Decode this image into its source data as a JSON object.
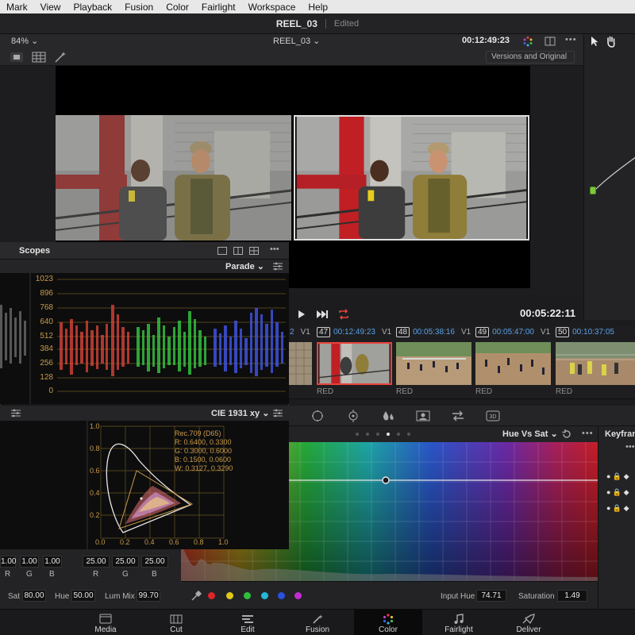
{
  "menubar": [
    "Mark",
    "View",
    "Playback",
    "Fusion",
    "Color",
    "Fairlight",
    "Workspace",
    "Help"
  ],
  "title": {
    "project": "REEL_03",
    "status": "Edited"
  },
  "viewer": {
    "zoom": "84%",
    "clip_name": "REEL_03",
    "timecode": "00:12:49:23",
    "compare_mode": "Versions and Original",
    "transport_timecode": "00:05:22:11"
  },
  "clips": [
    {
      "num": "47",
      "tc": "00:12:49:23",
      "track": "V1",
      "label": "RED"
    },
    {
      "num": "48",
      "tc": "00:05:38:16",
      "track": "V1",
      "label": "RED"
    },
    {
      "num": "49",
      "tc": "00:05:47:00",
      "track": "V1",
      "label": "RED"
    },
    {
      "num": "50",
      "tc": "00:10:37:05",
      "track": "V1",
      "label": "RED"
    }
  ],
  "clips_extra": {
    "prev_num_tail": "2",
    "prev_track": "V1",
    "first_label": "RED"
  },
  "scopes": {
    "title": "Scopes",
    "parade_mode": "Parade",
    "parade_ticks": [
      "1023",
      "896",
      "768",
      "640",
      "512",
      "384",
      "256",
      "128",
      "0"
    ],
    "cie_mode": "CIE 1931 xy",
    "cie_y_ticks": [
      "1.0",
      "0.8",
      "0.6",
      "0.4",
      "0.2"
    ],
    "cie_x_ticks": [
      "0.0",
      "0.2",
      "0.4",
      "0.6",
      "0.8",
      "1.0"
    ],
    "cie_info": [
      "Rec.709 (D65)",
      "R: 0.6400, 0.3300",
      "G: 0.3000, 0.6000",
      "B: 0.1500, 0.0600",
      "W: 0.3127, 0.3290"
    ]
  },
  "curves": {
    "mode": "Hue Vs Sat",
    "input_hue_label": "Input Hue",
    "input_hue_value": "74.71",
    "saturation_label": "Saturation",
    "saturation_value": "1.49",
    "swatches": [
      "#e0242a",
      "#e3c917",
      "#2fbf3b",
      "#25b7d8",
      "#2a52e0",
      "#c42bd1"
    ]
  },
  "keyframes_title": "Keyfram",
  "wheels": {
    "lift_vals": [
      "1.00",
      "1.00",
      "1.00"
    ],
    "lift_labels": [
      "R",
      "G",
      "B"
    ],
    "gain_vals": [
      "25.00",
      "25.00",
      "25.00"
    ],
    "gain_labels": [
      "R",
      "G",
      "B"
    ],
    "sat_label": "Sat",
    "sat_value": "80.00",
    "hue_label": "Hue",
    "hue_value": "50.00",
    "lummix_label": "Lum Mix",
    "lummix_value": "99.70"
  },
  "pages": [
    "Media",
    "Cut",
    "Edit",
    "Fusion",
    "Color",
    "Fairlight",
    "Deliver"
  ],
  "active_page": "Color"
}
